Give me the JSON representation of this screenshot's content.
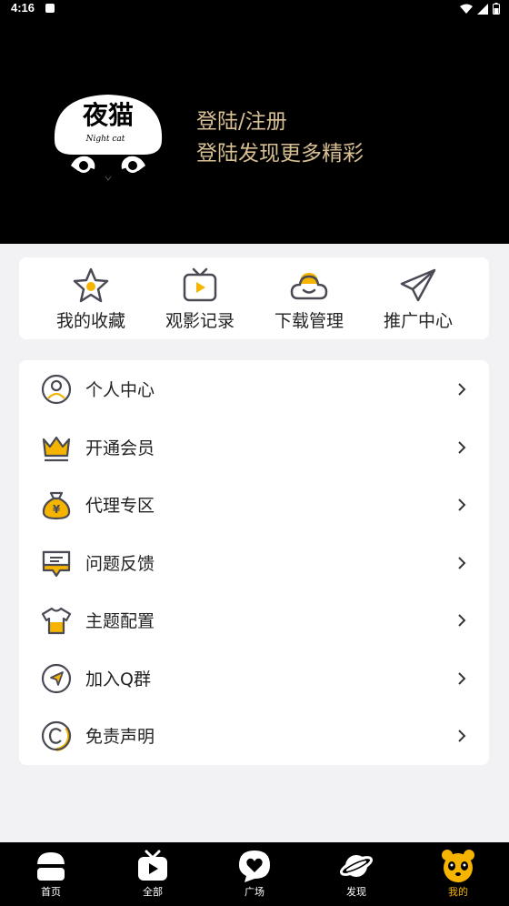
{
  "status_bar": {
    "time": "4:16"
  },
  "header": {
    "logo_text": "夜猫",
    "logo_sub": "Night cat",
    "login_title": "登陆/注册",
    "login_subtitle": "登陆发现更多精彩"
  },
  "quick_actions": [
    {
      "label": "我的收藏",
      "icon": "star-icon"
    },
    {
      "label": "观影记录",
      "icon": "tv-play-icon"
    },
    {
      "label": "下载管理",
      "icon": "cloud-icon"
    },
    {
      "label": "推广中心",
      "icon": "paper-plane-icon"
    }
  ],
  "menu": [
    {
      "label": "个人中心",
      "icon": "user-circle-icon"
    },
    {
      "label": "开通会员",
      "icon": "crown-icon"
    },
    {
      "label": "代理专区",
      "icon": "money-bag-icon"
    },
    {
      "label": "问题反馈",
      "icon": "feedback-icon"
    },
    {
      "label": "主题配置",
      "icon": "tshirt-icon"
    },
    {
      "label": "加入Q群",
      "icon": "navigation-icon"
    },
    {
      "label": "免责声明",
      "icon": "copyright-icon"
    }
  ],
  "tabs": [
    {
      "label": "首页",
      "icon": "home-icon",
      "active": false
    },
    {
      "label": "全部",
      "icon": "tv-icon",
      "active": false
    },
    {
      "label": "广场",
      "icon": "heart-bubble-icon",
      "active": false
    },
    {
      "label": "发现",
      "icon": "planet-icon",
      "active": false
    },
    {
      "label": "我的",
      "icon": "panda-icon",
      "active": true
    }
  ],
  "colors": {
    "accent": "#f4b400",
    "header_text": "#d8bf93",
    "icon_stroke": "#4a4a55"
  }
}
